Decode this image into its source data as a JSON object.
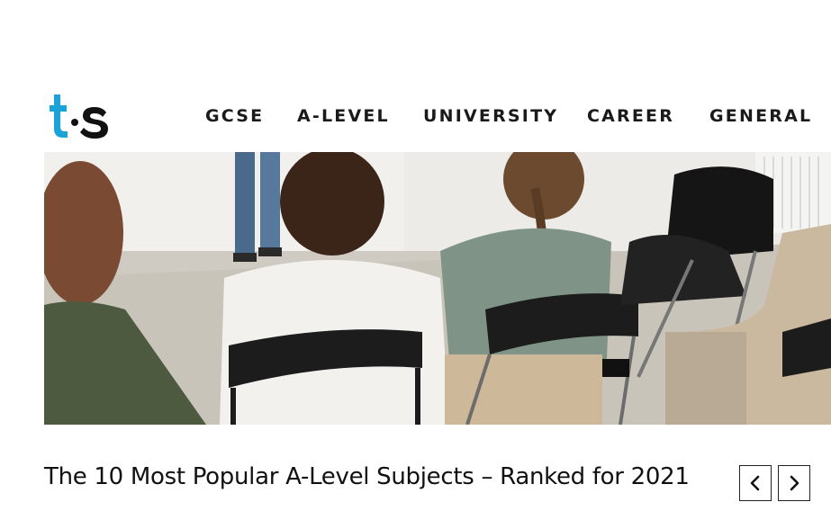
{
  "brand": {
    "logo_text": "ts",
    "accent": "#1aa3d9"
  },
  "nav": {
    "items": [
      "GCSE",
      "A-LEVEL",
      "UNIVERSITY",
      "CAREER",
      "GENERAL"
    ]
  },
  "hero": {
    "image": "students-seated-in-classroom"
  },
  "article": {
    "title": "The 10 Most Popular A-Level Subjects – Ranked for 2021"
  },
  "carousel": {
    "prev_icon": "chevron-left-icon",
    "next_icon": "chevron-right-icon"
  }
}
